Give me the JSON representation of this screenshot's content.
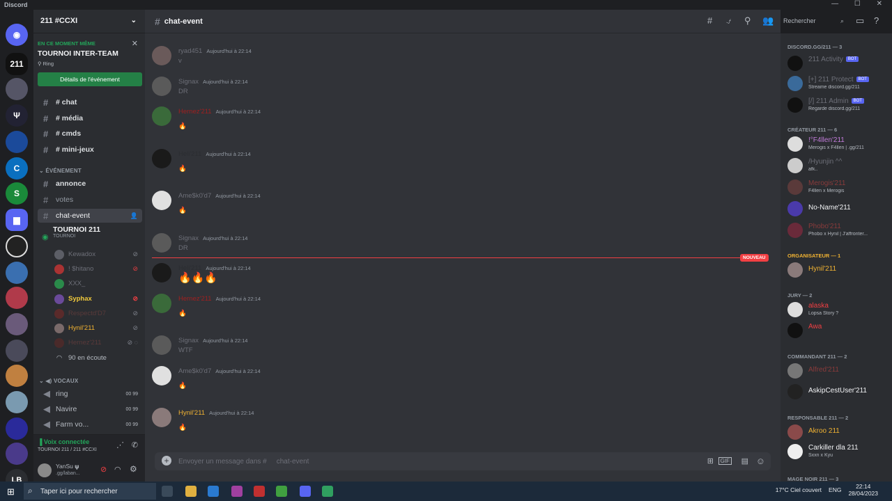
{
  "window": {
    "title": "Discord"
  },
  "server": {
    "name": "211 #CCXI"
  },
  "event": {
    "live_label": "EN CE MOMENT MÊME",
    "title": "TOURNOI INTER-TEAM",
    "location": "Ring",
    "button": "Détails de l'événement"
  },
  "channels": [
    {
      "label": "# chat"
    },
    {
      "label": "# média"
    },
    {
      "label": "# cmds"
    },
    {
      "label": "# mini-jeux"
    }
  ],
  "event_category": "ÉVÉNEMENT",
  "event_channels": [
    {
      "label": "annonce"
    },
    {
      "label": "votes"
    },
    {
      "label": "chat-event"
    }
  ],
  "stage": {
    "name": "TOURNOI 211",
    "sub": "TOURNOI"
  },
  "voice_users": [
    {
      "name": "Kewadox"
    },
    {
      "name": "! $hitano"
    },
    {
      "name": "XXX_"
    },
    {
      "name": "Syphax"
    },
    {
      "name": "Respectd'D7"
    },
    {
      "name": "Hynil'211"
    },
    {
      "name": "Hernez'211"
    }
  ],
  "listening": "90 en écoute",
  "voice_category": "VOCAUX",
  "voice_channels": [
    {
      "label": "ring",
      "count": "00 99"
    },
    {
      "label": "Navire",
      "count": "00 99"
    },
    {
      "label": "Farm vo...",
      "count": "00 99"
    }
  ],
  "voice_status": {
    "title": "Voix connectée",
    "sub": "TOURNOI 211 / 211 #CCXI"
  },
  "user": {
    "name": "YanSu 𝛙",
    "sub": ".gg/laban..."
  },
  "chat": {
    "channel": "chat-event",
    "new_badge": "NOUVEAU",
    "composer_placeholder": "Envoyer un message dans #",
    "messages": [
      {
        "author": "ryad451",
        "time": "Aujourd'hui à 22:14",
        "text": "v"
      },
      {
        "author": "Signax",
        "time": "Aujourd'hui à 22:14",
        "text": "DR"
      },
      {
        "author": "Hernez'211",
        "time": "Aujourd'hui à 22:14",
        "text": "🔥"
      },
      {
        "author": "Heli'211",
        "time": "Aujourd'hui à 22:14",
        "text": "🔥"
      },
      {
        "author": "Ame$k0'd7",
        "time": "Aujourd'hui à 22:14",
        "text": "🔥"
      },
      {
        "author": "Signax",
        "time": "Aujourd'hui à 22:14",
        "text": "DR"
      },
      {
        "author": "Heli'211",
        "time": "Aujourd'hui à 22:14",
        "text": "🔥🔥🔥"
      },
      {
        "author": "Hernez'211",
        "time": "Aujourd'hui à 22:14",
        "text": "🔥"
      },
      {
        "author": "Signax",
        "time": "Aujourd'hui à 22:14",
        "text": "WTF"
      },
      {
        "author": "Ame$k0'd7",
        "time": "Aujourd'hui à 22:14",
        "text": "🔥"
      },
      {
        "author": "Hynil'211",
        "time": "Aujourd'hui à 22:14",
        "text": "🔥"
      }
    ]
  },
  "search": {
    "placeholder": "Rechercher"
  },
  "members": {
    "groups": [
      {
        "label": "DISCORD.GG/211 — 3"
      },
      {
        "label": "CRÉATEUR 211 — 6"
      },
      {
        "label": "ORGANISATEUR — 1"
      },
      {
        "label": "JURY — 2"
      },
      {
        "label": "COMMANDANT 211 — 2"
      },
      {
        "label": "RESPONSABLE 211 — 2"
      },
      {
        "label": "MAGE NOIR 211 — 3"
      }
    ],
    "list": [
      {
        "name": "211 Activity",
        "status": "",
        "color": "#6d6f78"
      },
      {
        "name": "[+] 211 Protect",
        "status": "Streame discord.gg/211",
        "color": "#6d6f78"
      },
      {
        "name": "[/] 211 Admin",
        "status": "Regarde discord.gg/211",
        "color": "#6d6f78"
      },
      {
        "name": "!°F4llen'211",
        "status": "Merogis x F4llen | .gg/211",
        "color": "#c27cda"
      },
      {
        "name": "/Hyunjin ^^",
        "status": "afk..",
        "color": "#6d6f78"
      },
      {
        "name": "Merogis'211",
        "status": "F4llen x Merogis",
        "color": "#8a3b3b"
      },
      {
        "name": "No-Name'211",
        "status": "",
        "color": "#f2f3f5"
      },
      {
        "name": "Phobo'211",
        "status": "Phobo x Hynil | J'affronter...",
        "color": "#8a3b3b"
      },
      {
        "name": "Hynil'211",
        "status": "",
        "color": "#f0b232"
      },
      {
        "name": "alaska",
        "status": "Lopsa Story ?",
        "color": "#f23f43"
      },
      {
        "name": "Awa",
        "status": "",
        "color": "#f23f43"
      },
      {
        "name": "Alfred'211",
        "status": "",
        "color": "#8a3b3b"
      },
      {
        "name": "AskipCestUser'211",
        "status": "",
        "color": "#f2f3f5"
      },
      {
        "name": "Akroo 211",
        "status": "",
        "color": "#f0b232"
      },
      {
        "name": "Carkiller dla 211",
        "status": "Sxxn x Kyu",
        "color": "#f2f3f5"
      }
    ]
  },
  "taskbar": {
    "search": "Taper ici pour rechercher",
    "weather": "17°C Ciel couvert",
    "lang": "ENG",
    "time": "22:14",
    "date": "28/04/2023"
  },
  "colors": {
    "accent": "#23a55a",
    "blurple": "#5865f2",
    "danger": "#f23f43"
  }
}
